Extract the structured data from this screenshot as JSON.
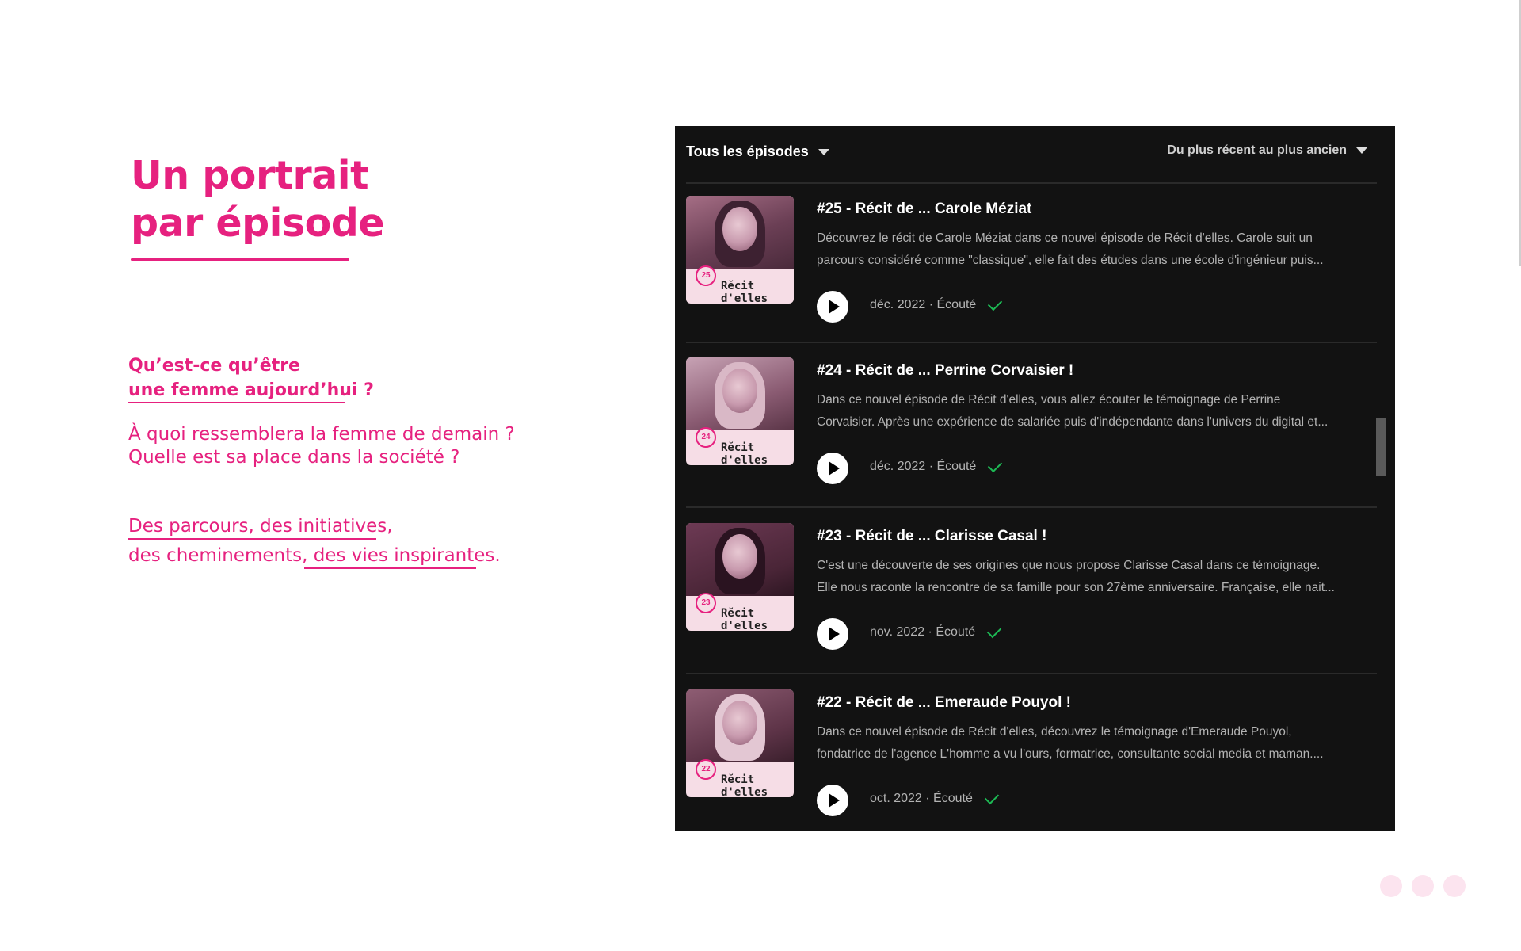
{
  "title": {
    "line1": "Un portrait",
    "line2": "par épisode"
  },
  "question": {
    "line1": "Qu’est-ce qu’être",
    "line2": "une femme aujourd’hui ?"
  },
  "subtext": {
    "line1": "À quoi ressemblera la femme de demain ?",
    "line2": "Quelle est sa place dans la société ?"
  },
  "parcours": {
    "part1": "Des parcours, des initiatives,",
    "part2": "des cheminements,",
    "part3": "des vies inspirantes."
  },
  "panel": {
    "filter_label": "Tous les épisodes",
    "sort_label": "Du plus récent au plus ancien",
    "brand": "Rĕcit d'elles",
    "episodes": [
      {
        "number": "25",
        "title": "#25 - Récit de ... Carole Méziat",
        "desc1": "Découvrez le récit de Carole Méziat dans ce nouvel épisode de Récit d'elles. Carole suit un",
        "desc2": "parcours considéré comme \"classique\", elle fait des études dans une école d'ingénieur puis...",
        "date": "déc. 2022 · Écouté"
      },
      {
        "number": "24",
        "title": "#24 - Récit de ... Perrine Corvaisier !",
        "desc1": "Dans ce nouvel épisode de Récit d'elles, vous allez écouter le témoignage de Perrine",
        "desc2": "Corvaisier. Après une expérience de salariée puis d'indépendante dans l'univers du digital et...",
        "date": "déc. 2022 · Écouté"
      },
      {
        "number": "23",
        "title": "#23 - Récit de ... Clarisse Casal !",
        "desc1": "C'est une découverte de ses origines que nous propose Clarisse Casal dans ce témoignage.",
        "desc2": "Elle nous raconte la rencontre de sa famille pour son 27ème anniversaire. Française, elle nait...",
        "date": "nov. 2022 · Écouté"
      },
      {
        "number": "22",
        "title": "#22 - Récit de ... Emeraude Pouyol !",
        "desc1": "Dans ce nouvel épisode de Récit d'elles, découvrez le témoignage d'Emeraude Pouyol,",
        "desc2": "fondatrice de l'agence L'homme a vu l'ours, formatrice, consultante social media et maman....",
        "date": "oct. 2022 · Écouté"
      }
    ]
  },
  "colors": {
    "accent": "#e6217f",
    "panel_bg": "#121212",
    "check": "#1db954"
  }
}
